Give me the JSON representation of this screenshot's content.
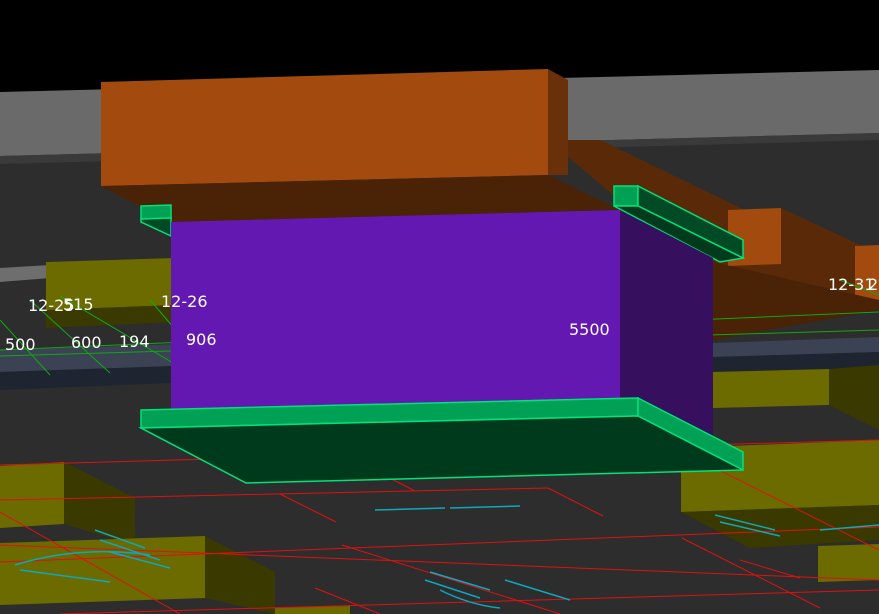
{
  "viewport": {
    "background": "#000000",
    "colors": {
      "beam": "#a34a0f",
      "column": "#6318b2",
      "slab_edge": "#00e27a",
      "wall": "#6b6b00",
      "grid_line": "#e01010",
      "axis_line": "#11a811",
      "annotation": "#0fa7bb"
    }
  },
  "labels": {
    "axis_12_25": "12-25",
    "num_515": "515",
    "axis_12_26": "12-26",
    "axis_12_31": "12-31",
    "num_2": "2",
    "num_500": "500",
    "num_600": "600",
    "num_194": "194",
    "num_906": "906",
    "num_5500": "5500"
  }
}
